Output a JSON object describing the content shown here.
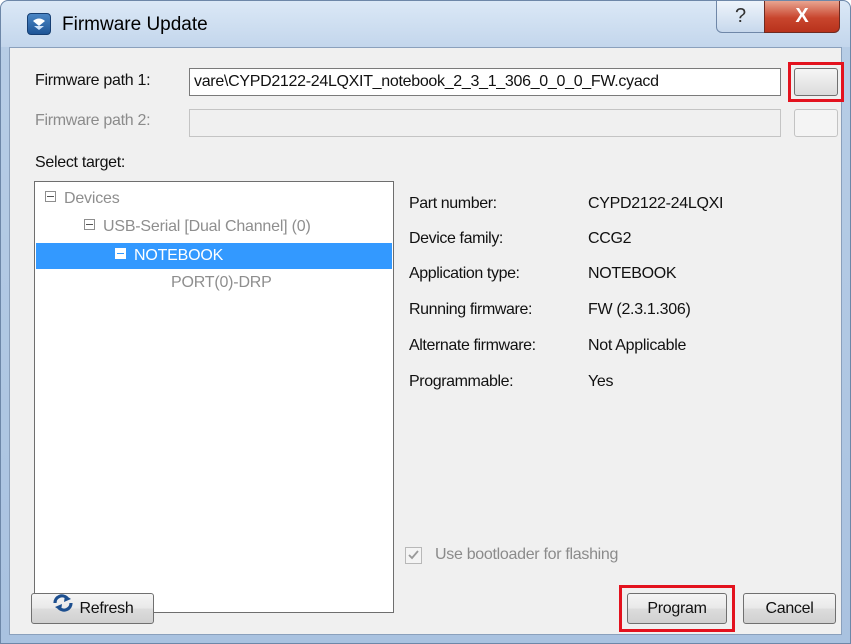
{
  "window": {
    "title": "Firmware Update",
    "help_glyph": "?",
    "close_glyph": "X",
    "icon": "app-logo-icon"
  },
  "firmware": {
    "path1_label": "Firmware path 1:",
    "path1_value": "vare\\CYPD2122-24LQXIT_notebook_2_3_1_306_0_0_0_FW.cyacd",
    "path2_label": "Firmware path 2:",
    "path2_value": ""
  },
  "target": {
    "label": "Select target:",
    "tree": [
      {
        "label": "Devices",
        "level": 0,
        "expander": "minus"
      },
      {
        "label": "USB-Serial [Dual Channel] (0)",
        "level": 1,
        "expander": "minus"
      },
      {
        "label": "NOTEBOOK",
        "level": 2,
        "expander": "minus",
        "selected": true
      },
      {
        "label": "PORT(0)-DRP",
        "level": 3
      }
    ]
  },
  "info": {
    "part_number_key": "Part number:",
    "part_number_val": "CYPD2122-24LQXI",
    "device_family_key": "Device family:",
    "device_family_val": "CCG2",
    "app_type_key": "Application type:",
    "app_type_val": "NOTEBOOK",
    "running_fw_key": "Running firmware:",
    "running_fw_val": "FW (2.3.1.306)",
    "alternate_fw_key": "Alternate firmware:",
    "alternate_fw_val": "Not Applicable",
    "programmable_key": "Programmable:",
    "programmable_val": "Yes"
  },
  "bootloader": {
    "label": "Use bootloader for flashing",
    "checked": true,
    "enabled": false
  },
  "buttons": {
    "refresh": "Refresh",
    "program": "Program",
    "cancel": "Cancel"
  },
  "colors": {
    "highlight": "#e3121e",
    "selection": "#3399ff"
  }
}
